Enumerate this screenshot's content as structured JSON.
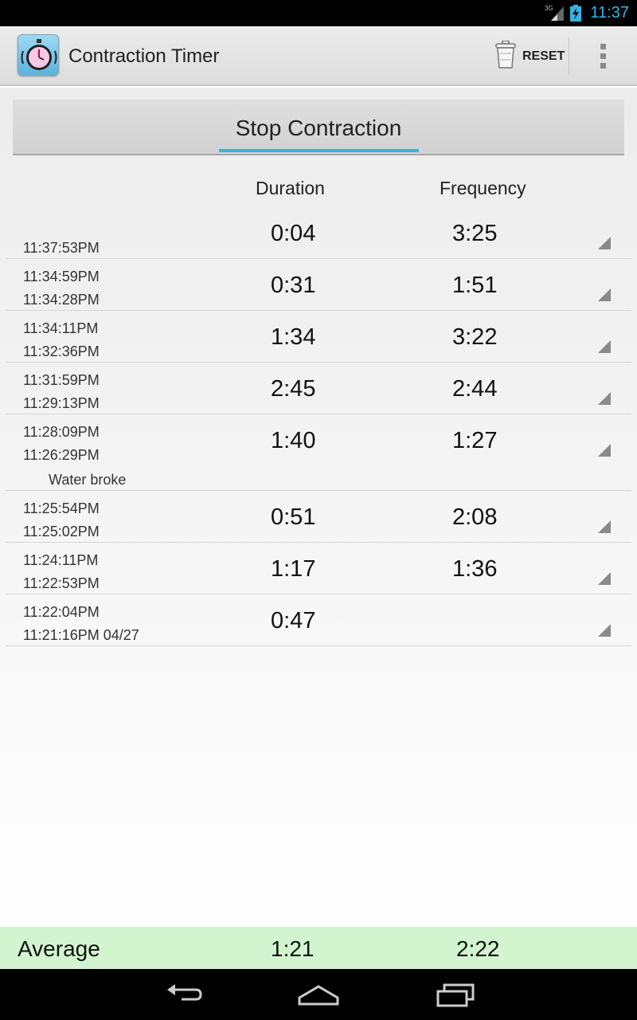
{
  "status_bar": {
    "time": "11:37",
    "network": "3G"
  },
  "action_bar": {
    "title": "Contraction Timer",
    "reset_label": "RESET"
  },
  "main": {
    "stop_button_label": "Stop Contraction",
    "columns": {
      "duration": "Duration",
      "frequency": "Frequency"
    },
    "rows": [
      {
        "start": "",
        "end": "11:37:53PM",
        "duration": "0:04",
        "frequency": "3:25",
        "note": ""
      },
      {
        "start": "11:34:59PM",
        "end": "11:34:28PM",
        "duration": "0:31",
        "frequency": "1:51",
        "note": ""
      },
      {
        "start": "11:34:11PM",
        "end": "11:32:36PM",
        "duration": "1:34",
        "frequency": "3:22",
        "note": ""
      },
      {
        "start": "11:31:59PM",
        "end": "11:29:13PM",
        "duration": "2:45",
        "frequency": "2:44",
        "note": ""
      },
      {
        "start": "11:28:09PM",
        "end": "11:26:29PM",
        "duration": "1:40",
        "frequency": "1:27",
        "note": "Water broke"
      },
      {
        "start": "11:25:54PM",
        "end": "11:25:02PM",
        "duration": "0:51",
        "frequency": "2:08",
        "note": ""
      },
      {
        "start": "11:24:11PM",
        "end": "11:22:53PM",
        "duration": "1:17",
        "frequency": "1:36",
        "note": ""
      },
      {
        "start": "11:22:04PM",
        "end": "11:21:16PM 04/27",
        "duration": "0:47",
        "frequency": "",
        "note": ""
      }
    ]
  },
  "footer": {
    "label": "Average",
    "duration": "1:21",
    "frequency": "2:22"
  },
  "colors": {
    "accent": "#33b5e5",
    "footer_bg": "#d2f5cf"
  },
  "icons": [
    "stopwatch-icon",
    "trash-icon",
    "overflow-menu-icon",
    "expand-icon",
    "back-icon",
    "home-icon",
    "recents-icon"
  ]
}
